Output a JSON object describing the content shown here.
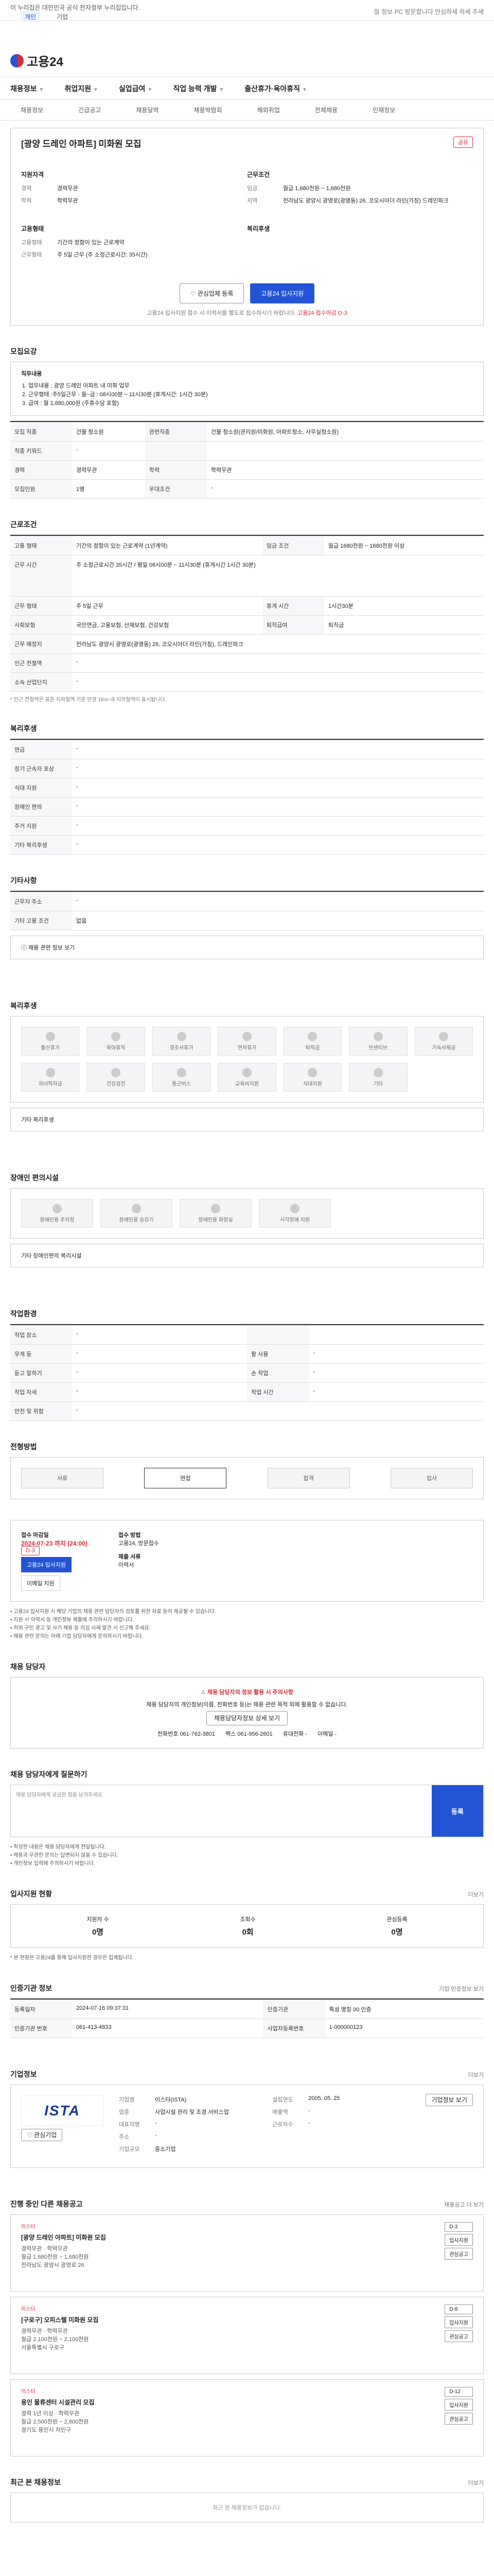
{
  "topbar": {
    "gov_notice": "이 누리집은 대한민국 공식 전자정부 누리집입니다.",
    "tabs": [
      "개인",
      "기업"
    ],
    "right_notice": "일 정보 PC 방문합니다 안심하세 하세 주세"
  },
  "logo": "고용24",
  "nav": {
    "items": [
      "채용정보",
      "취업지원",
      "실업급여",
      "직업 능력 개발",
      "출산휴가·육아휴직"
    ]
  },
  "subnav": {
    "items": [
      "채용정보",
      "긴급공고",
      "채용달력",
      "채용박람회",
      "해외취업",
      "전체채용",
      "인재정보"
    ]
  },
  "job": {
    "title": "[광양 드레인 아파트] 미화원 모집",
    "share_label": "공유",
    "recruit_cond_title": "지원자격",
    "recruit_cond": [
      {
        "k": "경력",
        "v": "경력무관"
      },
      {
        "k": "학력",
        "v": "학력무관"
      }
    ],
    "work_cond_title": "근무조건",
    "work_cond": [
      {
        "k": "임금",
        "v": "월급 1,680천원 ~ 1,680천원"
      },
      {
        "k": "지역",
        "v": "전라남도 광양시 광영로(광영동) 26, 코오시아더 라인(가칭) 드레인파크"
      }
    ],
    "emp_title": "고용형태",
    "emp": [
      {
        "k": "고용형태",
        "v": "기간의 정함이 있는 근로계약"
      },
      {
        "k": "근무형태",
        "v": "주 5일 근무 (주 소정근로시간: 35시간)"
      }
    ],
    "welfare_title": "복리후생"
  },
  "actions": {
    "bookmark": "관심업체 등록",
    "apply": "고용24 입사지원",
    "notice": "고용24 입사지원 접수 시 이력서를 별도로 접수하시기 바랍니다.",
    "notice_red": "고용24 접수마감 D-3"
  },
  "detail": {
    "section_title": "모집요강",
    "job_desc_title": "직무내용",
    "job_desc": [
      "업무내용 : 광양 드레인 아파트 내 미화 업무",
      "근무형태 :주5일근무 - 월~금 : 08시00분 ~ 11시30분 (휴게시간: 1시간 30분)",
      "급여 : 월 1,680,000원 (주휴수당 포함)"
    ],
    "rows": [
      {
        "k": "모집 직종",
        "v": "건물 청소원"
      },
      {
        "k": "관련직종",
        "v": "건물 청소원(관리원/미화원, 아파트청소, 사무실청소원)"
      },
      {
        "k": "직종 키워드",
        "v": "-"
      },
      {
        "k": "경력",
        "v": "경력무관"
      },
      {
        "k": "학력",
        "v": "학력무관"
      },
      {
        "k": "모집인원",
        "v": "1명"
      },
      {
        "k": "우대조건",
        "v": "-"
      }
    ]
  },
  "conditions": {
    "section_title": "근로조건",
    "rows": [
      {
        "k": "고용 형태",
        "v": "기간의 정함이 있는 근로계약 (1년계약)"
      },
      {
        "k": "임금 조건",
        "v": "월급 1680천원 ~ 1680천원 이상"
      },
      {
        "k": "근무 시간",
        "v": "주 소정근로시간 35시간 / 평일 08시00분 ~ 11시30분 (휴게시간 1시간 30분)"
      },
      {
        "k": "근무 형태",
        "v": "주 5일 근무"
      },
      {
        "k": "휴게 시간",
        "v": "1시간30분"
      },
      {
        "k": "사회보험",
        "v": "국민연금, 고용보험, 산재보험, 건강보험"
      },
      {
        "k": "퇴직급여",
        "v": "퇴직금"
      },
      {
        "k": "근무 예정지",
        "v": "전라남도 광양시 광영로(광영동) 26, 코오시아더 라인(가칭), 드레인파크"
      },
      {
        "k": "인근 전철역",
        "v": "-"
      },
      {
        "k": "소속 산업단지",
        "v": "-"
      }
    ],
    "footnote": "* 인근 전철역은 표준 지하철역 기준 반경 1Km 내 지하철역이 표시됩니다."
  },
  "welfare": {
    "section_title": "복리후생",
    "rows": [
      {
        "k": "연금",
        "v": "-"
      },
      {
        "k": "장기 근속자 포상",
        "v": "-"
      },
      {
        "k": "식대 지원",
        "v": "-"
      },
      {
        "k": "장애인 편의",
        "v": "-"
      },
      {
        "k": "주거 지원",
        "v": "-"
      },
      {
        "k": "기타 복리후생",
        "v": "-"
      }
    ]
  },
  "etc": {
    "section_title": "기타사항",
    "rows": [
      {
        "k": "근무지 주소",
        "v": "-"
      },
      {
        "k": "기타 고용 조건",
        "v": "없음"
      }
    ],
    "link": "채용 관련 정보 보기"
  },
  "benefits": {
    "section_title": "복리후생",
    "tiles": [
      "출산휴가",
      "육아휴직",
      "경조사휴가",
      "연차휴가",
      "퇴직금",
      "인센티브",
      "기숙사제공",
      "자녀학자금",
      "건강검진",
      "통근버스",
      "교육비지원",
      "식대지원",
      "기타"
    ],
    "extra_label": "기타 복리후생"
  },
  "disabled": {
    "section_title": "장애인 편의시설",
    "tiles": [
      "장애인용 주차장",
      "장애인용 승강기",
      "장애인용 화장실",
      "시각장애 지원"
    ],
    "extra_label": "기타 장애인편의 복리시설"
  },
  "env": {
    "section_title": "작업환경",
    "rows": [
      {
        "k": "작업 장소",
        "v": "-"
      },
      {
        "k": "무게 등",
        "v": "-"
      },
      {
        "k": "팔 사용",
        "v": "-"
      },
      {
        "k": "듣고 말하기",
        "v": "-"
      },
      {
        "k": "손 작업",
        "v": "-"
      },
      {
        "k": "작업 자세",
        "v": "-"
      },
      {
        "k": "작업 시간",
        "v": "-"
      },
      {
        "k": "안전 및 위험",
        "v": "-"
      }
    ]
  },
  "process": {
    "section_title": "전형방법",
    "steps": [
      "서류",
      "면접",
      "합격",
      "입사"
    ]
  },
  "apply": {
    "period_label": "접수 마감일",
    "deadline": "2024-07-23 까지 (24:00)",
    "dday": "D-3",
    "apply_btn": "고용24 입사지원",
    "mail_btn": "이메일 지원",
    "method_label": "접수 방법",
    "method": "고용24, 방문접수",
    "docs_label": "제출 서류",
    "docs": "이력서",
    "notes": [
      "고용24 입사지원 시 해당 기업의 채용 관련 담당자의 검토를 위한 자료 등이 제공될 수 있습니다.",
      "지원 시 이력서 등 개인정보 제출에 주의하시기 바랍니다.",
      "허위 구인 광고 및 사기 채용 등 의심 사례 발견 시 신고해 주세요.",
      "채용 관련 문의는 아래 기업 담당자에게 문의하시기 바랍니다."
    ]
  },
  "contact": {
    "section_title": "채용 담당자",
    "warning": "채용 담당자의 정보 활용 시 주의사항",
    "text": "채용 담당자의 개인정보(이름, 전화번호 등)는 채용 관련 목적 외에 활용할 수 없습니다.",
    "button": "채용담당자정보 상세 보기",
    "fields": [
      {
        "k": "전화번호",
        "v": "061-762-3801"
      },
      {
        "k": "팩스",
        "v": "061-956-2601"
      },
      {
        "k": "휴대전화",
        "v": "-"
      },
      {
        "k": "이메일",
        "v": "-"
      }
    ]
  },
  "qa": {
    "section_title": "채용 담당자에게 질문하기",
    "placeholder": "채용 담당자에게 궁금한 점을 남겨주세요.",
    "button": "등록",
    "notes": [
      "작성한 내용은 채용 담당자에게 전달됩니다.",
      "채용과 무관한 문의는 답변되지 않을 수 있습니다.",
      "개인정보 입력에 주의하시기 바랍니다."
    ]
  },
  "stats": {
    "section_title": "입사지원 현황",
    "more": "더보기",
    "items": [
      {
        "label": "지원자 수",
        "value": "0명"
      },
      {
        "label": "조회수",
        "value": "0회"
      },
      {
        "label": "관심등록",
        "value": "0명"
      }
    ],
    "note": "* 본 현황은 고용24를 통해 입사지원한 경우만 집계됩니다."
  },
  "announce": {
    "section_title": "인증기관 정보",
    "more": "기업 인증정보 보기",
    "rows": [
      {
        "k": "등록일자",
        "v": "2024-07-16 09:37:31"
      },
      {
        "k": "인증기관",
        "v": "특성 명칭 00 인증"
      },
      {
        "k": "인증기관 번호",
        "v": "061-413-4833"
      },
      {
        "k": "사업자등록번호",
        "v": "1-000000123"
      }
    ]
  },
  "company": {
    "section_title": "기업정보",
    "more": "더보기",
    "logo_text": "ISTA",
    "rows": [
      {
        "k": "기업명",
        "v": "이스타(ISTA)"
      },
      {
        "k": "업종",
        "v": "사업시설 관리 및 조경 서비스업"
      },
      {
        "k": "대표자명",
        "v": "-"
      },
      {
        "k": "주소",
        "v": "-"
      },
      {
        "k": "기업규모",
        "v": "중소기업"
      }
    ],
    "fav_label": "관심기업",
    "stats": [
      {
        "k": "설립연도",
        "v": "2005. 05. 25"
      },
      {
        "k": "매출액",
        "v": "-"
      },
      {
        "k": "근로자수",
        "v": "-"
      }
    ],
    "view_btn": "기업정보 보기"
  },
  "rec": {
    "section_title": "진행 중인 다른 채용공고",
    "more": "채용공고 더 보기",
    "items": [
      {
        "company": "이스타",
        "title": "[광양 드레인 아파트] 미화원 모집",
        "meta": [
          "경력무관 · 학력무관",
          "월급 1,680천원 ~ 1,680천원",
          "전라남도 광양시 광영로 26"
        ],
        "dday": "D-3",
        "btns": [
          "입사지원",
          "관심공고"
        ]
      },
      {
        "company": "이스타",
        "title": "[구로구] 오피스텔 미화원 모집",
        "meta": [
          "경력무관 · 학력무관",
          "월급 2,100천원 ~ 2,100천원",
          "서울특별시 구로구"
        ],
        "dday": "D-8",
        "btns": [
          "입사지원",
          "관심공고"
        ]
      },
      {
        "company": "이스타",
        "title": "용인 물류센터 시설관리 모집",
        "meta": [
          "경력 1년 이상 · 학력무관",
          "월급 2,500천원 ~ 2,800천원",
          "경기도 용인시 처인구"
        ],
        "dday": "D-12",
        "btns": [
          "입사지원",
          "관심공고"
        ]
      }
    ]
  },
  "recent": {
    "section_title": "최근 본 채용정보",
    "more": "더보기",
    "empty": "최근 본 채용정보가 없습니다."
  }
}
